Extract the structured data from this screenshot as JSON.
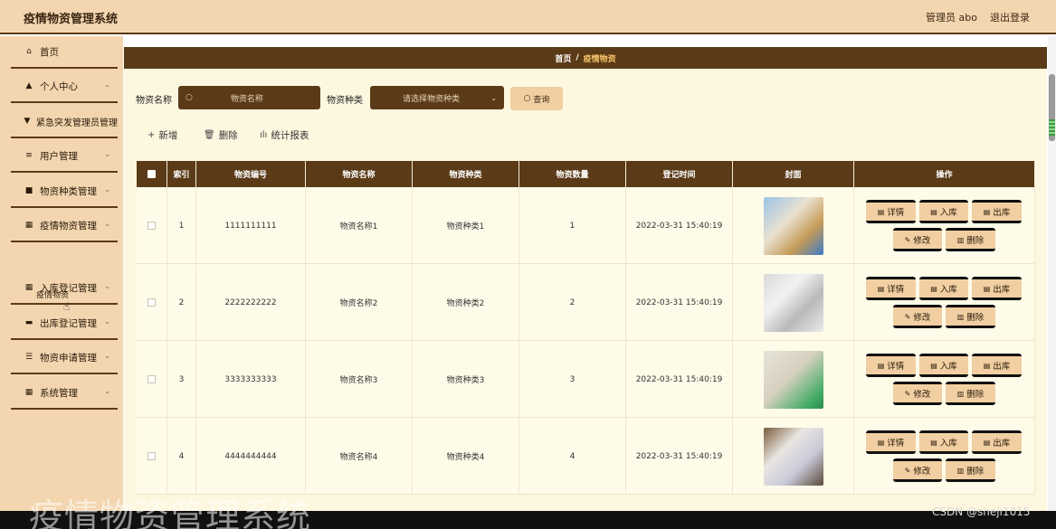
{
  "header": {
    "title": "疫情物资管理系统",
    "admin_label": "管理员 abo",
    "logout_label": "退出登录"
  },
  "sidebar": {
    "items": [
      {
        "label": "首页",
        "icon": "home-icon",
        "glyph": "⌂",
        "has_chevron": false
      },
      {
        "label": "个人中心",
        "icon": "user-icon",
        "glyph": "▲",
        "has_chevron": true
      },
      {
        "label": "紧急突发管理员管理",
        "icon": "alert-icon",
        "glyph": "▼",
        "has_chevron": false
      },
      {
        "label": "用户管理",
        "icon": "list-icon",
        "glyph": "≡",
        "has_chevron": true
      },
      {
        "label": "物资种类管理",
        "icon": "box-icon",
        "glyph": "■",
        "has_chevron": true
      },
      {
        "label": "疫情物资管理",
        "icon": "grid-icon",
        "glyph": "▦",
        "has_chevron": true
      },
      {
        "label": "入库登记管理",
        "icon": "grid-icon",
        "glyph": "▦",
        "has_chevron": true
      },
      {
        "label": "出库登记管理",
        "icon": "ticket-icon",
        "glyph": "▬",
        "has_chevron": true
      },
      {
        "label": "物资申请管理",
        "icon": "sliders-icon",
        "glyph": "☰",
        "has_chevron": true
      },
      {
        "label": "系统管理",
        "icon": "grid-icon",
        "glyph": "▦",
        "has_chevron": true
      }
    ],
    "subitem": "疫情物资"
  },
  "breadcrumb": {
    "home": "首页",
    "separator": "/",
    "current": "疫情物资"
  },
  "search": {
    "name_label": "物资名称",
    "name_placeholder": "物资名称",
    "type_label": "物资种类",
    "type_placeholder": "请选择物资种类",
    "query_label": "查询"
  },
  "actions": {
    "add": "新增",
    "delete": "删除",
    "report": "统计报表"
  },
  "table": {
    "headers": [
      "索引",
      "物资编号",
      "物资名称",
      "物资种类",
      "物资数量",
      "登记时间",
      "封面",
      "操作"
    ],
    "rows": [
      {
        "index": "1",
        "code": "1111111111",
        "name": "物资名称1",
        "type": "物资种类1",
        "qty": "1",
        "time": "2022-03-31 15:40:19"
      },
      {
        "index": "2",
        "code": "2222222222",
        "name": "物资名称2",
        "type": "物资种类2",
        "qty": "2",
        "time": "2022-03-31 15:40:19"
      },
      {
        "index": "3",
        "code": "3333333333",
        "name": "物资名称3",
        "type": "物资种类3",
        "qty": "3",
        "time": "2022-03-31 15:40:19"
      },
      {
        "index": "4",
        "code": "4444444444",
        "name": "物资名称4",
        "type": "物资种类4",
        "qty": "4",
        "time": "2022-03-31 15:40:19"
      }
    ],
    "row_buttons": {
      "detail": "详情",
      "stock_in": "入库",
      "stock_out": "出库",
      "edit": "修改",
      "delete": "删除"
    }
  },
  "overlay": {
    "watermark": "疫情物资管理系统",
    "credit": "CSDN @sheji1015"
  },
  "colors": {
    "header_bg": "#f3d6b0",
    "accent_dark": "#5b3b17",
    "content_bg": "#fdf7df",
    "button_bg": "#f1cfa2",
    "breadcrumb_current": "#f6c36a"
  }
}
